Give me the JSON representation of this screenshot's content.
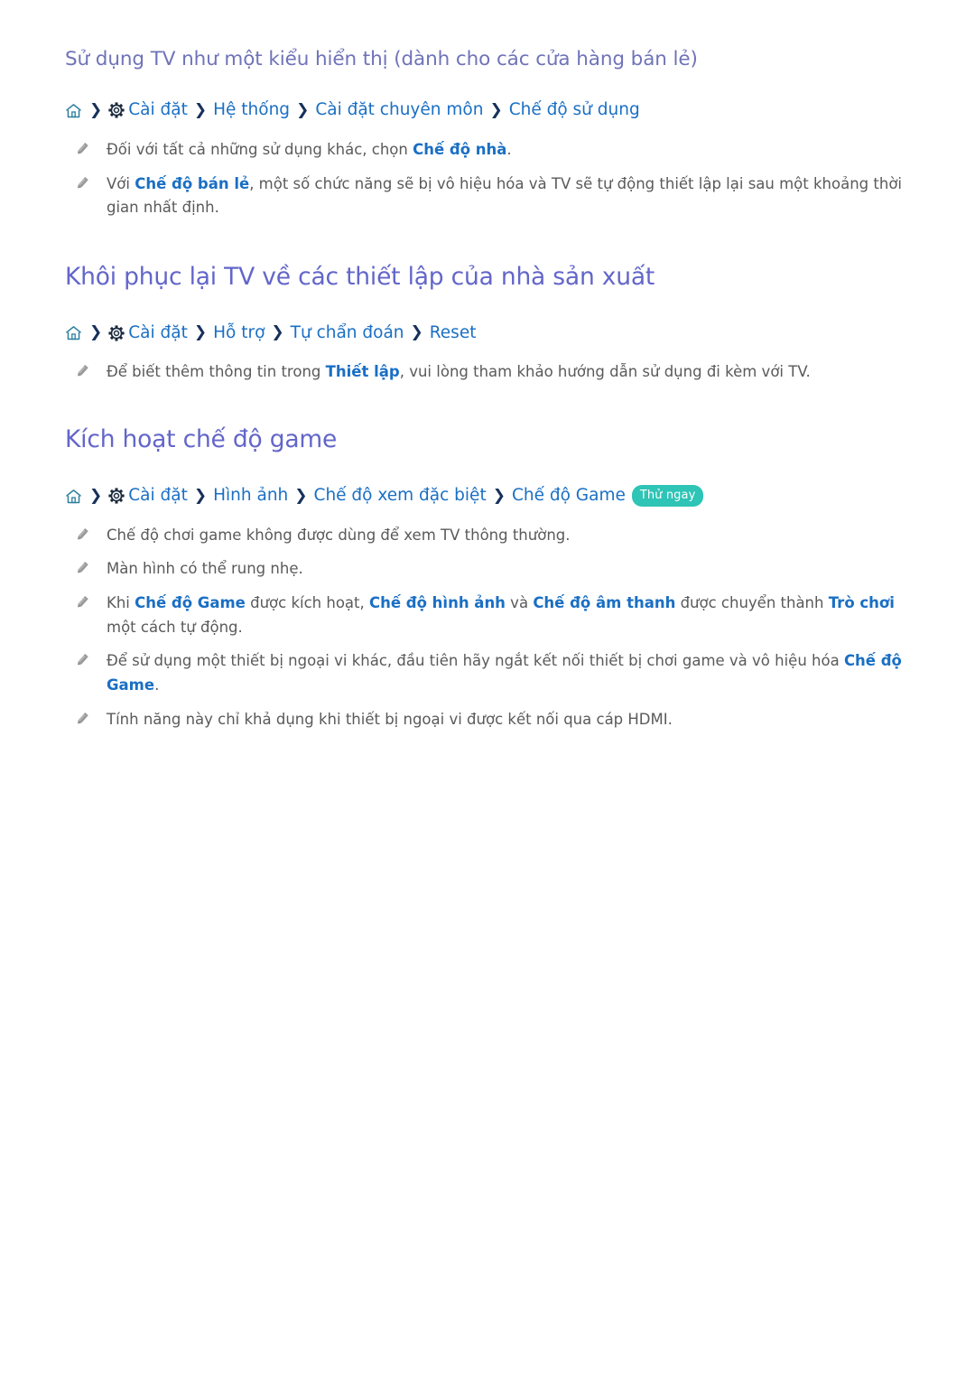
{
  "icons": {
    "home": "home-icon",
    "gear": "gear-icon",
    "chevron": "chevron-right-icon",
    "pencil": "pencil-note-icon"
  },
  "colors": {
    "heading_sub": "#6f73b8",
    "heading_main": "#6366c9",
    "link": "#1a6fc4",
    "chevron": "#17315c",
    "body": "#5a5a5a",
    "badge_bg": "#2ec4b6",
    "badge_text": "#ffffff",
    "home_icon": "#2f7f9e"
  },
  "chevron_glyph": "❯",
  "sections": [
    {
      "heading": "Sử dụng TV như một kiểu hiển thị (dành cho các cửa hàng bán lẻ)",
      "heading_level": "sub",
      "breadcrumb": {
        "segments": [
          "Cài đặt",
          "Hệ thống",
          "Cài đặt chuyên môn",
          "Chế độ sử dụng"
        ],
        "badge": ""
      },
      "notes": [
        [
          {
            "t": "Đối với tất cả những sử dụng khác, chọn ",
            "b": false
          },
          {
            "t": "Chế độ nhà",
            "b": true
          },
          {
            "t": ".",
            "b": false
          }
        ],
        [
          {
            "t": "Với ",
            "b": false
          },
          {
            "t": "Chế độ bán lẻ",
            "b": true
          },
          {
            "t": ", một số chức năng sẽ bị vô hiệu hóa và TV sẽ tự động thiết lập lại sau một khoảng thời gian nhất định.",
            "b": false
          }
        ]
      ]
    },
    {
      "heading": "Khôi phục lại TV về các thiết lập của nhà sản xuất",
      "heading_level": "main",
      "breadcrumb": {
        "segments": [
          "Cài đặt",
          "Hỗ trợ",
          "Tự chẩn đoán",
          "Reset"
        ],
        "badge": ""
      },
      "notes": [
        [
          {
            "t": "Để biết thêm thông tin trong ",
            "b": false
          },
          {
            "t": "Thiết lập",
            "b": true
          },
          {
            "t": ", vui lòng tham khảo hướng dẫn sử dụng đi kèm với TV.",
            "b": false
          }
        ]
      ]
    },
    {
      "heading": "Kích hoạt chế độ game",
      "heading_level": "main",
      "breadcrumb": {
        "segments": [
          "Cài đặt",
          "Hình ảnh",
          "Chế độ xem đặc biệt",
          "Chế độ Game"
        ],
        "badge": "Thử ngay"
      },
      "notes": [
        [
          {
            "t": "Chế độ chơi game không được dùng để xem TV thông thường.",
            "b": false
          }
        ],
        [
          {
            "t": "Màn hình có thể rung nhẹ.",
            "b": false
          }
        ],
        [
          {
            "t": "Khi ",
            "b": false
          },
          {
            "t": "Chế độ Game",
            "b": true
          },
          {
            "t": " được kích hoạt, ",
            "b": false
          },
          {
            "t": "Chế độ hình ảnh",
            "b": true
          },
          {
            "t": " và ",
            "b": false
          },
          {
            "t": "Chế độ âm thanh",
            "b": true
          },
          {
            "t": " được chuyển thành ",
            "b": false
          },
          {
            "t": "Trò chơi",
            "b": true
          },
          {
            "t": " một cách tự động.",
            "b": false
          }
        ],
        [
          {
            "t": "Để sử dụng một thiết bị ngoại vi khác, đầu tiên hãy ngắt kết nối thiết bị chơi game và vô hiệu hóa ",
            "b": false
          },
          {
            "t": "Chế độ Game",
            "b": true
          },
          {
            "t": ".",
            "b": false
          }
        ],
        [
          {
            "t": "Tính năng này chỉ khả dụng khi thiết bị ngoại vi được kết nối qua cáp HDMI.",
            "b": false
          }
        ]
      ]
    }
  ]
}
